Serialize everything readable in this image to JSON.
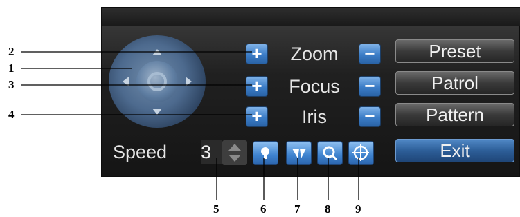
{
  "controls": {
    "zoom": {
      "label": "Zoom",
      "plus": "+",
      "minus": "−"
    },
    "focus": {
      "label": "Focus",
      "plus": "+",
      "minus": "−"
    },
    "iris": {
      "label": "Iris",
      "plus": "+",
      "minus": "−"
    }
  },
  "buttons": {
    "preset": "Preset",
    "patrol": "Patrol",
    "pattern": "Pattern",
    "exit": "Exit"
  },
  "speed": {
    "label": "Speed",
    "value": "3"
  },
  "icons": {
    "joystick": "ptz-direction-pad-icon",
    "icon6": "light-icon",
    "icon7": "wiper-icon",
    "icon8": "zoom-in-icon",
    "icon9": "center-target-icon"
  },
  "callouts": [
    "1",
    "2",
    "3",
    "4",
    "5",
    "6",
    "7",
    "8",
    "9"
  ],
  "colors": {
    "panel": "#1a1a1a",
    "accent": "#3b7cc6",
    "text": "#e6e6e6"
  }
}
